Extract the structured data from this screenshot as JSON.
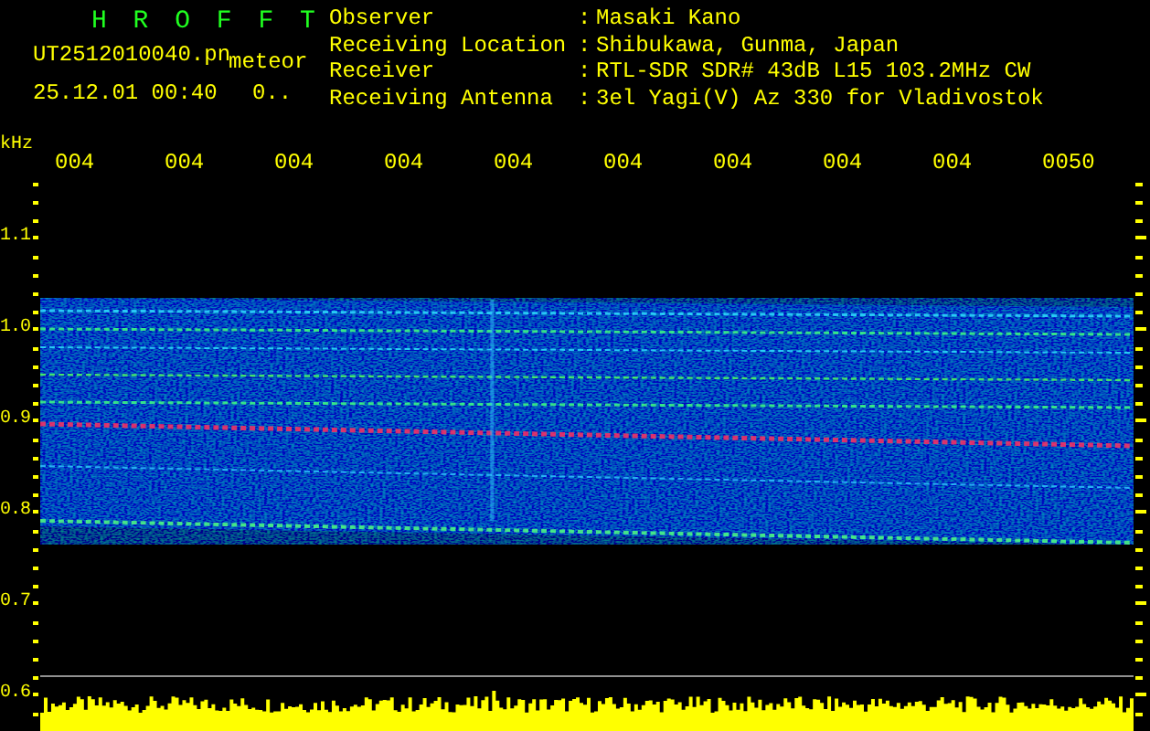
{
  "header": {
    "app_title": "H R O F F T",
    "file_name": "UT2512010040.pn",
    "tag": "meteor",
    "timestamp": "25.12.01 00:40",
    "status": "0.."
  },
  "info": [
    {
      "label": "Observer",
      "value": "Masaki Kano"
    },
    {
      "label": "Receiving Location",
      "value": "Shibukawa, Gunma, Japan"
    },
    {
      "label": "Receiver",
      "value": "RTL-SDR SDR# 43dB L15 103.2MHz CW"
    },
    {
      "label": "Receiving Antenna",
      "value": "3el Yagi(V) Az 330 for Vladivostok"
    }
  ],
  "separator": ":",
  "y_axis": {
    "unit": "kHz",
    "labels": [
      "1.1",
      "1.0",
      "0.9",
      "0.8",
      "0.7",
      "0.6"
    ]
  },
  "time_labels": [
    "004",
    "004",
    "004",
    "004",
    "004",
    "004",
    "004",
    "004",
    "004",
    "0050"
  ]
}
